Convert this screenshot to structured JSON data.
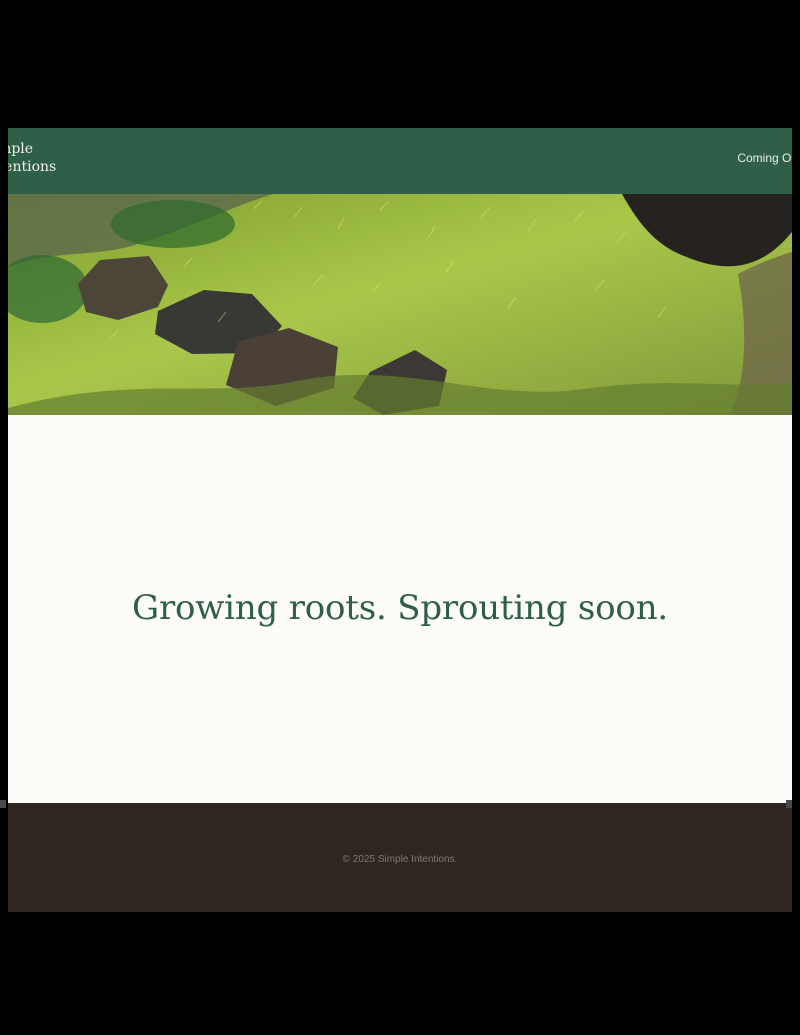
{
  "header": {
    "brand_line_1": "Simple",
    "brand_line_2": "Intentions",
    "nav_link": "Coming Our"
  },
  "main": {
    "tagline": "Growing roots. Sprouting soon."
  },
  "footer": {
    "copyright": "© 2025 Simple Intentions."
  },
  "colors": {
    "header_bg": "#2f5f49",
    "main_bg": "#fdfcf8",
    "footer_bg": "#2e2621",
    "tagline": "#2f5f49"
  }
}
